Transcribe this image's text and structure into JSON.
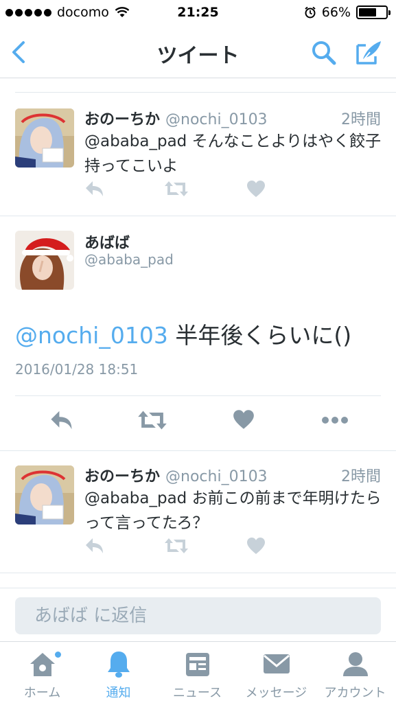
{
  "status_bar": {
    "carrier": "docomo",
    "time": "21:25",
    "battery": "66%",
    "battery_level": 0.66
  },
  "nav": {
    "title": "ツイート"
  },
  "tweets": [
    {
      "name": "おのーちか",
      "handle": "@nochi_0103",
      "time": "2時間",
      "text": "@ababa_pad そんなことよりはやく餃子持ってこいよ"
    },
    {
      "name": "おのーちか",
      "handle": "@nochi_0103",
      "time": "2時間",
      "text": "@ababa_pad お前この前まで年明けたらって言ってたろ？"
    }
  ],
  "main_tweet": {
    "name": "あばば",
    "handle": "@ababa_pad",
    "mention": "@nochi_0103",
    "text": " 半年後くらいに()",
    "date": "2016/01/28 18:51"
  },
  "reply": {
    "placeholder": "あばば に返信"
  },
  "tabs": [
    {
      "label": "ホーム",
      "icon": "home-icon"
    },
    {
      "label": "通知",
      "icon": "bell-icon"
    },
    {
      "label": "ニュース",
      "icon": "news-icon"
    },
    {
      "label": "メッセージ",
      "icon": "envelope-icon"
    },
    {
      "label": "アカウント",
      "icon": "person-icon"
    }
  ],
  "colors": {
    "accent": "#55acee",
    "icon_gray": "#8899a6",
    "text": "#292f33"
  }
}
